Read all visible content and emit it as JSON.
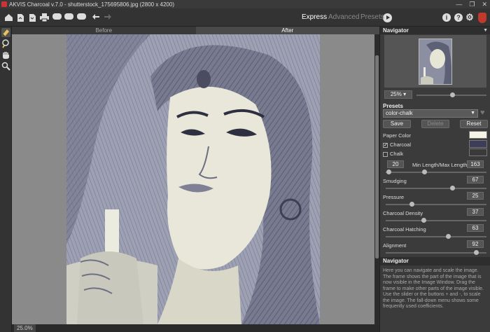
{
  "window": {
    "title": "AKVIS Charcoal v.7.0 - shutterstock_175695806.jpg (2800 x 4200)",
    "controls": [
      "—",
      "❐",
      "✕"
    ]
  },
  "toolbar": {
    "icons": [
      "home-icon",
      "open-icon",
      "save-icon",
      "print-icon",
      "share-icon",
      "batch-icon",
      "plugin-icon",
      "undo-icon",
      "redo-icon",
      "run-icon"
    ],
    "modes": {
      "express": "Express",
      "advanced": "Advanced",
      "presets": "Presets"
    },
    "right_icons": [
      "info-icon",
      "help-icon",
      "settings-icon",
      "akvis-logo"
    ]
  },
  "tools": [
    "eraser-icon",
    "history-brush-icon",
    "hand-icon",
    "zoom-icon"
  ],
  "view_tabs": {
    "before": "Before",
    "after": "After"
  },
  "status": {
    "zoom": "25.0%"
  },
  "navigator": {
    "title": "Navigator",
    "zoom": "25%",
    "zoom_slider_fraction": 0.52
  },
  "presets": {
    "label": "Presets",
    "selected": "color-chalk",
    "save": "Save",
    "delete": "Delete",
    "reset": "Reset"
  },
  "params": {
    "paper_color": {
      "label": "Paper Color",
      "color": "#f6f4e4"
    },
    "charcoal": {
      "label": "Charcoal",
      "checked": true,
      "color": "#3c3d57"
    },
    "chalk": {
      "label": "Chalk",
      "checked": false,
      "color": "#3a3a3a"
    },
    "min_length": "20",
    "min_max_label": "Min Length/Max Length",
    "max_length": "163",
    "smudging": {
      "label": "Smudging",
      "value": "67"
    },
    "pressure": {
      "label": "Pressure",
      "value": "25"
    },
    "charcoal_density": {
      "label": "Charcoal Density",
      "value": "37"
    },
    "charcoal_hatching": {
      "label": "Charcoal Hatching",
      "value": "63"
    },
    "alignment": {
      "label": "Alignment",
      "value": "92"
    }
  },
  "help": {
    "title": "Navigator",
    "text": "Here you can navigate and scale the image. The frame shows the part of the image that is now visible in the Image Window. Drag the frame to make other parts of the image visible. Use the slider or the buttons + and -, to scale the image. The fall-down menu shows some frequently used coefficients."
  }
}
